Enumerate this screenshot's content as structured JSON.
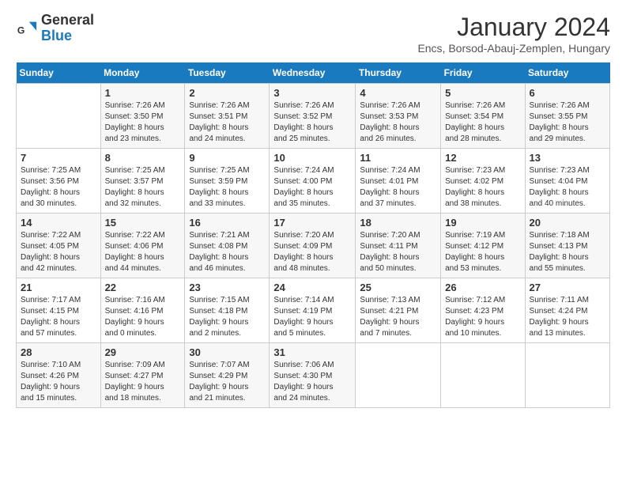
{
  "logo": {
    "text_general": "General",
    "text_blue": "Blue"
  },
  "header": {
    "month_title": "January 2024",
    "subtitle": "Encs, Borsod-Abauj-Zemplen, Hungary"
  },
  "days_of_week": [
    "Sunday",
    "Monday",
    "Tuesday",
    "Wednesday",
    "Thursday",
    "Friday",
    "Saturday"
  ],
  "weeks": [
    [
      {
        "day": "",
        "info": ""
      },
      {
        "day": "1",
        "info": "Sunrise: 7:26 AM\nSunset: 3:50 PM\nDaylight: 8 hours\nand 23 minutes."
      },
      {
        "day": "2",
        "info": "Sunrise: 7:26 AM\nSunset: 3:51 PM\nDaylight: 8 hours\nand 24 minutes."
      },
      {
        "day": "3",
        "info": "Sunrise: 7:26 AM\nSunset: 3:52 PM\nDaylight: 8 hours\nand 25 minutes."
      },
      {
        "day": "4",
        "info": "Sunrise: 7:26 AM\nSunset: 3:53 PM\nDaylight: 8 hours\nand 26 minutes."
      },
      {
        "day": "5",
        "info": "Sunrise: 7:26 AM\nSunset: 3:54 PM\nDaylight: 8 hours\nand 28 minutes."
      },
      {
        "day": "6",
        "info": "Sunrise: 7:26 AM\nSunset: 3:55 PM\nDaylight: 8 hours\nand 29 minutes."
      }
    ],
    [
      {
        "day": "7",
        "info": "Sunrise: 7:25 AM\nSunset: 3:56 PM\nDaylight: 8 hours\nand 30 minutes."
      },
      {
        "day": "8",
        "info": "Sunrise: 7:25 AM\nSunset: 3:57 PM\nDaylight: 8 hours\nand 32 minutes."
      },
      {
        "day": "9",
        "info": "Sunrise: 7:25 AM\nSunset: 3:59 PM\nDaylight: 8 hours\nand 33 minutes."
      },
      {
        "day": "10",
        "info": "Sunrise: 7:24 AM\nSunset: 4:00 PM\nDaylight: 8 hours\nand 35 minutes."
      },
      {
        "day": "11",
        "info": "Sunrise: 7:24 AM\nSunset: 4:01 PM\nDaylight: 8 hours\nand 37 minutes."
      },
      {
        "day": "12",
        "info": "Sunrise: 7:23 AM\nSunset: 4:02 PM\nDaylight: 8 hours\nand 38 minutes."
      },
      {
        "day": "13",
        "info": "Sunrise: 7:23 AM\nSunset: 4:04 PM\nDaylight: 8 hours\nand 40 minutes."
      }
    ],
    [
      {
        "day": "14",
        "info": "Sunrise: 7:22 AM\nSunset: 4:05 PM\nDaylight: 8 hours\nand 42 minutes."
      },
      {
        "day": "15",
        "info": "Sunrise: 7:22 AM\nSunset: 4:06 PM\nDaylight: 8 hours\nand 44 minutes."
      },
      {
        "day": "16",
        "info": "Sunrise: 7:21 AM\nSunset: 4:08 PM\nDaylight: 8 hours\nand 46 minutes."
      },
      {
        "day": "17",
        "info": "Sunrise: 7:20 AM\nSunset: 4:09 PM\nDaylight: 8 hours\nand 48 minutes."
      },
      {
        "day": "18",
        "info": "Sunrise: 7:20 AM\nSunset: 4:11 PM\nDaylight: 8 hours\nand 50 minutes."
      },
      {
        "day": "19",
        "info": "Sunrise: 7:19 AM\nSunset: 4:12 PM\nDaylight: 8 hours\nand 53 minutes."
      },
      {
        "day": "20",
        "info": "Sunrise: 7:18 AM\nSunset: 4:13 PM\nDaylight: 8 hours\nand 55 minutes."
      }
    ],
    [
      {
        "day": "21",
        "info": "Sunrise: 7:17 AM\nSunset: 4:15 PM\nDaylight: 8 hours\nand 57 minutes."
      },
      {
        "day": "22",
        "info": "Sunrise: 7:16 AM\nSunset: 4:16 PM\nDaylight: 9 hours\nand 0 minutes."
      },
      {
        "day": "23",
        "info": "Sunrise: 7:15 AM\nSunset: 4:18 PM\nDaylight: 9 hours\nand 2 minutes."
      },
      {
        "day": "24",
        "info": "Sunrise: 7:14 AM\nSunset: 4:19 PM\nDaylight: 9 hours\nand 5 minutes."
      },
      {
        "day": "25",
        "info": "Sunrise: 7:13 AM\nSunset: 4:21 PM\nDaylight: 9 hours\nand 7 minutes."
      },
      {
        "day": "26",
        "info": "Sunrise: 7:12 AM\nSunset: 4:23 PM\nDaylight: 9 hours\nand 10 minutes."
      },
      {
        "day": "27",
        "info": "Sunrise: 7:11 AM\nSunset: 4:24 PM\nDaylight: 9 hours\nand 13 minutes."
      }
    ],
    [
      {
        "day": "28",
        "info": "Sunrise: 7:10 AM\nSunset: 4:26 PM\nDaylight: 9 hours\nand 15 minutes."
      },
      {
        "day": "29",
        "info": "Sunrise: 7:09 AM\nSunset: 4:27 PM\nDaylight: 9 hours\nand 18 minutes."
      },
      {
        "day": "30",
        "info": "Sunrise: 7:07 AM\nSunset: 4:29 PM\nDaylight: 9 hours\nand 21 minutes."
      },
      {
        "day": "31",
        "info": "Sunrise: 7:06 AM\nSunset: 4:30 PM\nDaylight: 9 hours\nand 24 minutes."
      },
      {
        "day": "",
        "info": ""
      },
      {
        "day": "",
        "info": ""
      },
      {
        "day": "",
        "info": ""
      }
    ]
  ]
}
